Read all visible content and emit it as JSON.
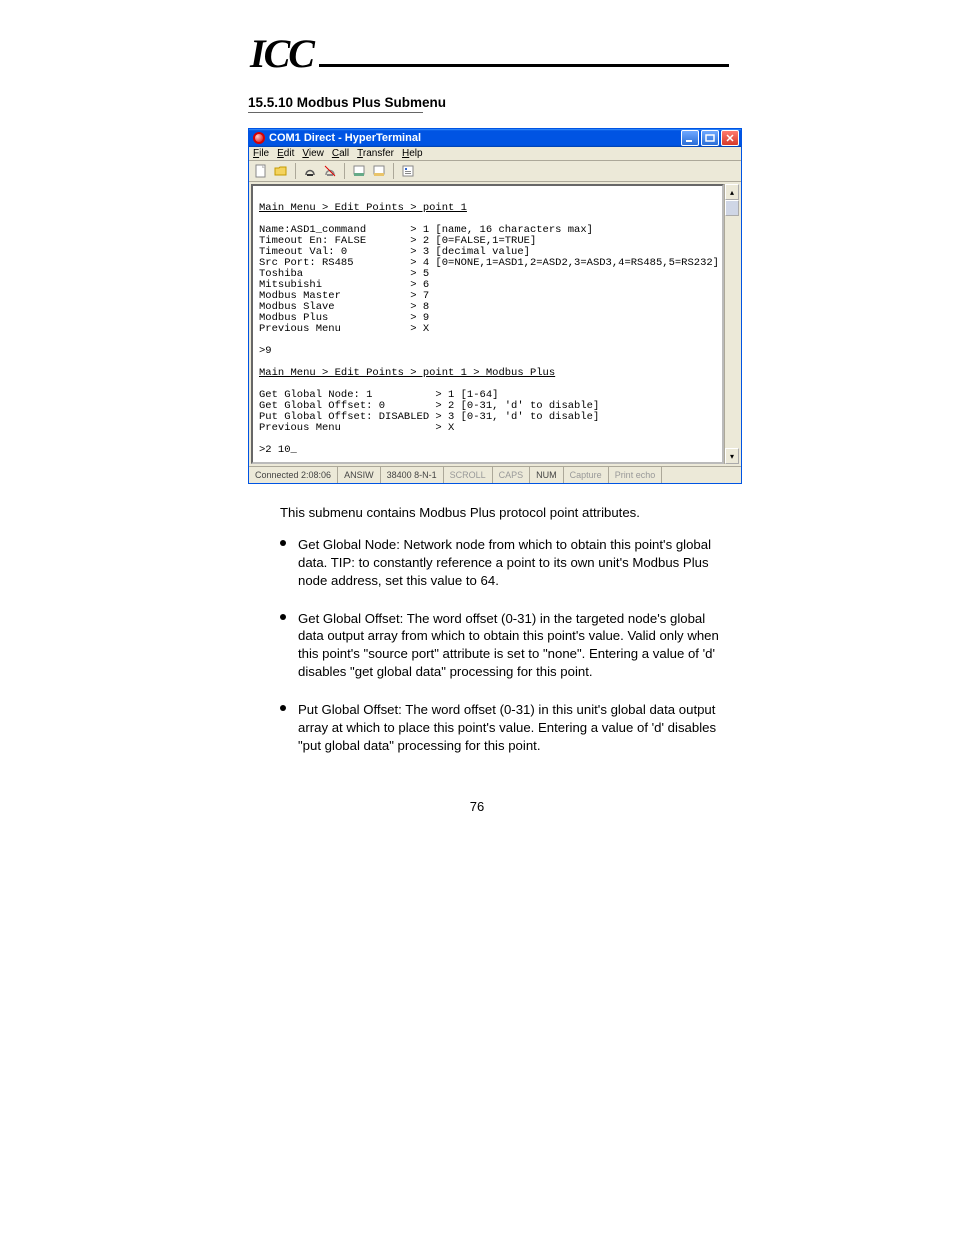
{
  "header": {
    "logo": "ICC"
  },
  "section": {
    "title": "15.5.10 Modbus Plus Submenu"
  },
  "window": {
    "title": "COM1 Direct - HyperTerminal",
    "min_label": "_",
    "max_label": "☐",
    "close_label": "×"
  },
  "menubar": [
    "File",
    "Edit",
    "View",
    "Call",
    "Transfer",
    "Help"
  ],
  "toolbar_icons": [
    "new-icon",
    "open-icon",
    "save-icon",
    "disconnect-icon",
    "call-icon",
    "properties-icon",
    "send-icon"
  ],
  "terminal": {
    "breadcrumb1": "Main Menu > Edit Points > point 1",
    "lines1": [
      "Name:ASD1_command       > 1 [name, 16 characters max]",
      "Timeout En: FALSE       > 2 [0=FALSE,1=TRUE]",
      "Timeout Val: 0          > 3 [decimal value]",
      "Src Port: RS485         > 4 [0=NONE,1=ASD1,2=ASD2,3=ASD3,4=RS485,5=RS232]",
      "Toshiba                 > 5",
      "Mitsubishi              > 6",
      "Modbus Master           > 7",
      "Modbus Slave            > 8",
      "Modbus Plus             > 9",
      "Previous Menu           > X",
      "",
      ">9"
    ],
    "breadcrumb2": "Main Menu > Edit Points > point 1 > Modbus Plus",
    "lines2": [
      "Get Global Node: 1          > 1 [1-64]",
      "Get Global Offset: 0        > 2 [0-31, 'd' to disable]",
      "Put Global Offset: DISABLED > 3 [0-31, 'd' to disable]",
      "Previous Menu               > X",
      "",
      ">2 10_"
    ]
  },
  "statusbar": {
    "connected": "Connected 2:08:06",
    "autodetect": "ANSIW",
    "baud": "38400 8-N-1",
    "scroll": "SCROLL",
    "caps": "CAPS",
    "num": "NUM",
    "capture": "Capture",
    "printecho": "Print echo"
  },
  "doc": {
    "intro": "This submenu contains Modbus Plus protocol point attributes.",
    "bullets": [
      "Get Global Node: Network node from which to obtain this point's global data. TIP: to constantly reference a point to its own unit's Modbus Plus node address, set this value to 64.",
      "Get Global Offset: The word offset (0-31) in the targeted node's global data output array from which to obtain this point's value. Valid only when this point's \"source port\" attribute is set to \"none\". Entering a value of 'd' disables \"get global data\" processing for this point.",
      "Put Global Offset: The word offset (0-31) in this unit's global data output array at which to place this point's value. Entering a value of 'd' disables \"put global data\" processing for this point."
    ]
  },
  "page_number": "76"
}
